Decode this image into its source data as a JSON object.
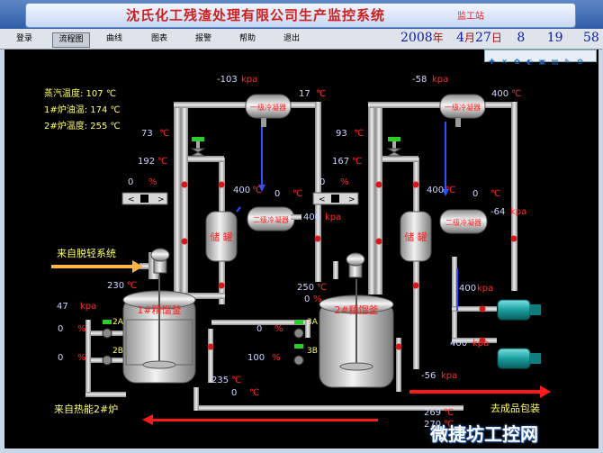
{
  "window": {
    "title": "沈氏化工残渣处理有限公司生产监控系统",
    "station": "监工站"
  },
  "menu": [
    "登录",
    "流程图",
    "曲线",
    "图表",
    "报警",
    "帮助",
    "退出"
  ],
  "datetime": {
    "year": "2008",
    "year_unit": "年",
    "month": "4",
    "month_unit": "月",
    "day": "27",
    "day_unit": "日",
    "hour": "8",
    "minute": "19",
    "second": "58"
  },
  "left_status": {
    "steam_temp_label": "蒸汽温度: 107 ℃",
    "furnace1_oil_label": "1#炉油温: 174 ℃",
    "furnace2_temp_label": "2#炉温度: 255 ℃"
  },
  "unit1": {
    "condenser1_label": "一级冷凝器",
    "condenser1_pressure": "-103",
    "condenser1_temp": "17",
    "condenser2_label": "二级冷凝器",
    "condenser2_temp": "0",
    "condenser2_pressure": "400",
    "receiver_label": "储 罐",
    "receiver_temp": "400",
    "column_top_temp": "73",
    "column_mid_temp": "192",
    "valve_percent": "0",
    "still_label": "1#精馏釜",
    "still_temp": "230",
    "still_pressure": "47",
    "feed_2a": "0",
    "feed_2b": "0",
    "still_bottom_temp1": "235",
    "still_bottom_temp2": "0"
  },
  "unit2": {
    "condenser1_label": "一级冷凝器",
    "condenser1_pressure": "-58",
    "condenser1_temp": "400",
    "condenser2_label": "二级冷凝器",
    "condenser2_temp": "0",
    "condenser2_pressure": "-64",
    "receiver_label": "储 罐",
    "receiver_temp": "400",
    "column_top_temp": "93",
    "column_mid_temp": "167",
    "valve_percent": "0",
    "still_label": "2#精馏釜",
    "still_temp": "250",
    "still_pressure": "0",
    "feed_3a": "0",
    "feed_3b": "100",
    "still_bottom_pressure": "-56",
    "still_bottom_temp1": "269",
    "still_bottom_temp2": "270",
    "pump1_pressure": "400",
    "pump2_pressure": "400"
  },
  "labels": {
    "from_light_system": "来自脱轻系统",
    "from_heat2": "来自热能2#炉",
    "to_packaging": "去成品包装",
    "tag_2a": "2A",
    "tag_2b": "2B",
    "tag_3a": "3A",
    "tag_3b": "3B",
    "unit_kpa": "kpa",
    "unit_c": "℃",
    "unit_pct": "%"
  },
  "watermark": "微捷坊工控网",
  "colors": {
    "background": "#000000",
    "pipe": "#c8c8c8",
    "value_blue": "#1a3cff",
    "unit_red": "#ff2a2a",
    "tank_label": "#ff2020",
    "arrow_red": "#ff1a1a",
    "text_yellow": "#ffff66",
    "pump_cyan": "#18a0a0"
  }
}
